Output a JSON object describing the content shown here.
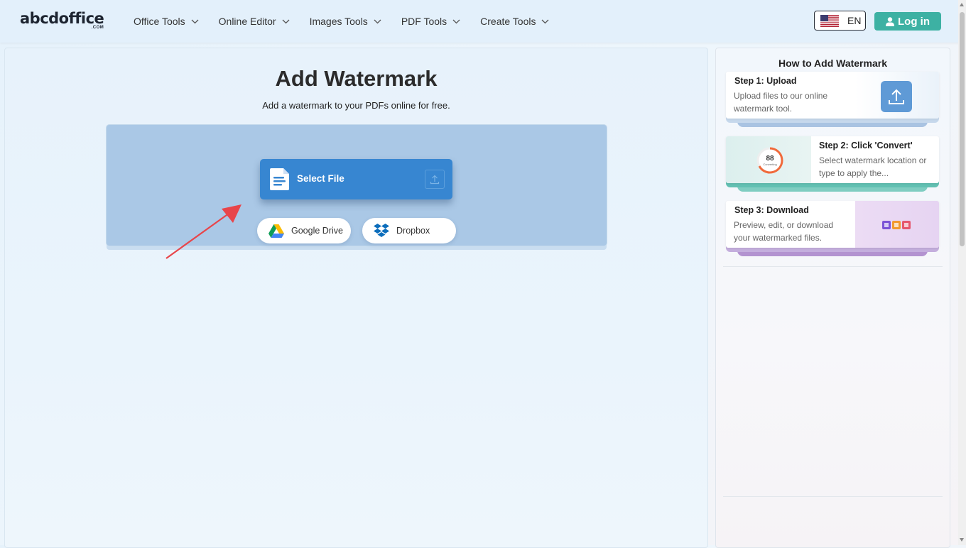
{
  "header": {
    "logo_main": "abcdoffice",
    "logo_sub": ".COM",
    "nav": [
      {
        "label": "Office Tools"
      },
      {
        "label": "Online Editor"
      },
      {
        "label": "Images Tools"
      },
      {
        "label": "PDF Tools"
      },
      {
        "label": "Create Tools"
      }
    ],
    "language": "EN",
    "login_label": "Log in"
  },
  "main": {
    "title": "Add Watermark",
    "subtitle": "Add a watermark to your PDFs online for free.",
    "select_file_label": "Select File",
    "google_drive_label": "Google Drive",
    "dropbox_label": "Dropbox"
  },
  "sidebar": {
    "title": "How to Add Watermark",
    "steps": [
      {
        "title": "Step 1: Upload",
        "desc": "Upload files to our online watermark tool."
      },
      {
        "title": "Step 2: Click 'Convert'",
        "desc": "Select watermark location or type to apply the...",
        "progress_label": "88",
        "progress_sub": "Converting"
      },
      {
        "title": "Step 3: Download",
        "desc": "Preview, edit, or download your watermarked files."
      }
    ]
  },
  "colors": {
    "accent_teal": "#3db1a3",
    "upload_blue": "#3786d1",
    "drop_zone": "#aac8e6",
    "step1_tray": "#b7cde6",
    "step2_tray": "#6cc5b8",
    "step3_tray": "#b79bd4",
    "arrow_red": "#e8454a"
  }
}
